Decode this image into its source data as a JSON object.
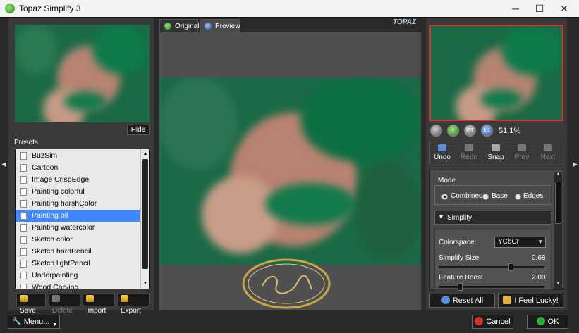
{
  "window": {
    "title": "Topaz Simplify 3",
    "minimize": "─",
    "maximize": "☐",
    "close": "✕"
  },
  "left": {
    "hide_label": "Hide",
    "presets_label": "Presets",
    "presets": [
      "BuzSim",
      "Cartoon",
      "Image CrispEdge",
      "Painting colorful",
      "Painting harshColor",
      "Painting oil",
      "Painting watercolor",
      "Sketch color",
      "Sketch hardPencil",
      "Sketch lightPencil",
      "Underpainting",
      "Wood Carving"
    ],
    "selected_preset": "Painting oil",
    "buttons": {
      "save": "Save",
      "delete": "Delete",
      "import": "Import",
      "export": "Export"
    }
  },
  "center": {
    "tab_original": "Original",
    "tab_preview": "Preview",
    "active_tab": "Preview",
    "logo": "TOPAZ"
  },
  "right": {
    "zoom_level": "51.1%",
    "zoom_buttons": [
      "-",
      "+",
      "FIT",
      "1:1"
    ],
    "history": {
      "undo": "Undo",
      "redo": "Redo",
      "snap": "Snap",
      "prev": "Prev",
      "next": "Next"
    },
    "mode_label": "Mode",
    "modes": [
      "Combined",
      "Base",
      "Edges"
    ],
    "selected_mode": "Combined",
    "section_title": "Simplify",
    "colorspace_label": "Colorspace:",
    "colorspace_value": "YCbCr",
    "sliders": [
      {
        "label": "Simplify Size",
        "value": "0.68",
        "fraction": 0.68
      },
      {
        "label": "Feature Boost",
        "value": "2.00",
        "fraction": 0.2
      }
    ],
    "reset_all": "Reset All",
    "feel_lucky": "I Feel Lucky!"
  },
  "bottom": {
    "menu": "Menu...",
    "cancel": "Cancel",
    "ok": "OK"
  },
  "colors": {
    "accent_selection": "#3f86ff",
    "preview_border": "#d8322a",
    "panel_bg": "#3a3a3a"
  }
}
